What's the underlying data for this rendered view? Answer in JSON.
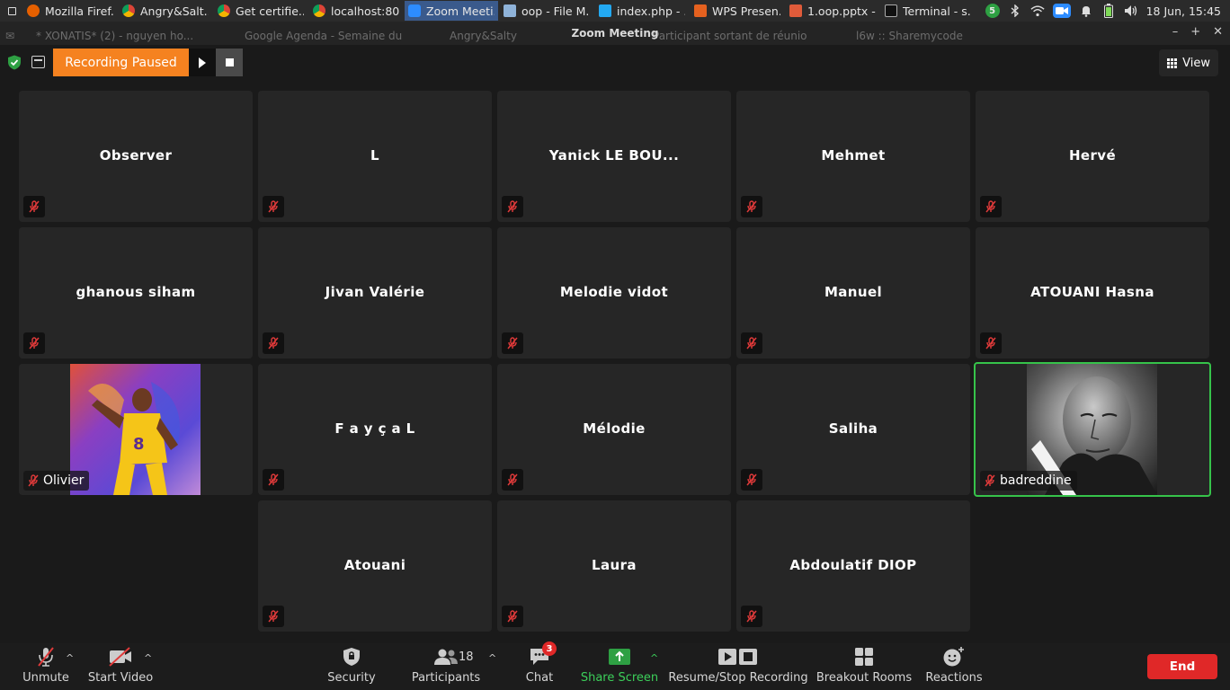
{
  "taskbar": {
    "tasks": [
      {
        "label": "Mozilla Firef...",
        "icon": "firefox-icon"
      },
      {
        "label": "Angry&Salt...",
        "icon": "chrome-icon"
      },
      {
        "label": "Get certifie...",
        "icon": "chrome-icon"
      },
      {
        "label": "localhost:80...",
        "icon": "chrome-icon"
      },
      {
        "label": "Zoom Meeti...",
        "icon": "zoom-icon"
      },
      {
        "label": "oop - File M...",
        "icon": "folder-icon"
      },
      {
        "label": "index.php - ...",
        "icon": "vscode-icon"
      },
      {
        "label": "WPS Presen...",
        "icon": "wps-icon"
      },
      {
        "label": "1.oop.pptx - ...",
        "icon": "wps-doc-icon"
      },
      {
        "label": "Terminal - s...",
        "icon": "terminal-icon"
      }
    ],
    "tray": {
      "update_count": "5",
      "clock": "18 Jun, 15:45"
    }
  },
  "browser_strip": {
    "window_title": "Zoom Meeting",
    "ghost_tabs": [
      "* XONATIS* (2) - nguyen ho...",
      "Google Agenda - Semaine du",
      "Angry&Salty",
      "Participant sortant de réunio",
      "l6w :: Sharemycode"
    ]
  },
  "topbar": {
    "recording_status": "Recording Paused",
    "view_label": "View"
  },
  "participants": [
    {
      "name": "Observer"
    },
    {
      "name": "L"
    },
    {
      "name": "Yanick LE BOU..."
    },
    {
      "name": "Mehmet"
    },
    {
      "name": "Hervé"
    },
    {
      "name": "ghanous siham"
    },
    {
      "name": "Jivan Valérie"
    },
    {
      "name": "Melodie vidot"
    },
    {
      "name": "Manuel"
    },
    {
      "name": "ATOUANI Hasna"
    },
    {
      "name": "Olivier",
      "video": true
    },
    {
      "name": "F a y ç a L"
    },
    {
      "name": "Mélodie"
    },
    {
      "name": "Saliha"
    },
    {
      "name": "badreddine",
      "video": true,
      "active_speaker": true
    },
    {
      "name": "Atouani"
    },
    {
      "name": "Laura"
    },
    {
      "name": "Abdoulatif DIOP"
    }
  ],
  "toolbar": {
    "unmute": "Unmute",
    "start_video": "Start Video",
    "security": "Security",
    "participants": "Participants",
    "participant_count": "18",
    "chat": "Chat",
    "chat_unread": "3",
    "share_screen": "Share Screen",
    "recording": "Resume/Stop Recording",
    "breakout": "Breakout Rooms",
    "reactions": "Reactions",
    "end": "End"
  },
  "colors": {
    "recording_paused": "#f58220",
    "share_green": "#3ccf5a",
    "end_red": "#e02828",
    "active_speaker_border": "#36c34a"
  }
}
